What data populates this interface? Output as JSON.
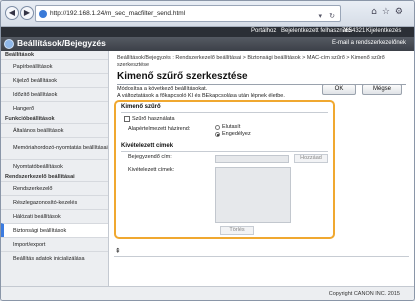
{
  "browser": {
    "url": "http://192.168.1.24/m_sec_macfilter_send.html",
    "back_icon": "back-arrow-icon",
    "forward_icon": "forward-arrow-icon"
  },
  "topbar": {
    "portal": "Portálhoz",
    "login_user": "Bejelentkezett felhasználó:",
    "user_id": "7654321",
    "logout": "Kijelentkezés"
  },
  "header": {
    "title": "Beállítások/Bejegyzés",
    "admin_mail": "E-mail a rendszerkezelőnek"
  },
  "sidebar": {
    "section_settings": "Beállítások",
    "item_paper": "Papírbeállítások",
    "item_display": "Kijelző beállítások",
    "item_timer": "Időzítő beállítások",
    "item_sound": "Hangerő",
    "section_functions": "Funkcióbeállítások",
    "item_general": "Általános beállítások",
    "item_store_access": "Memóriahordozó-nyomtatás beállításai",
    "item_printer": "Nyomtatóbeállítások",
    "section_admin": "Rendszerkezelő beállításai",
    "item_sysadmin": "Rendszerkezelő",
    "item_dept": "Részlegazonosító-kezelés",
    "item_network": "Hálózati beállítások",
    "item_security": "Biztonsági beállítások",
    "item_import": "Import/export",
    "item_init": "Beállítás adatok inicializálása"
  },
  "main": {
    "breadcrumb": "Beállítások/Bejegyzés : Rendszerkezelő beállításai > Biztonsági beállítások > MAC-cím szűrő > Kimenő szűrő szerkesztése",
    "title": "Kimenő szűrő szerkesztése",
    "instruction_1": "Módosítsa a következő beállításokat.",
    "instruction_2": "A változtatások a főkapcsoló KI és BEkapcsolása után lépnek életbe.",
    "ok_label": "OK",
    "cancel_label": "Mégse",
    "group_filter": "Kimenő szűrő",
    "use_filter_label": "Szűrő használata",
    "default_policy_label": "Alapértelmezett házirend:",
    "reject_label": "Elutasít",
    "allow_label": "Engedélyez",
    "group_exceptions": "Kivételezett címek",
    "address_label": "Bejegyzendő cím:",
    "add_label": "Hozzáad",
    "exceptions_label": "Kivételezett címek:",
    "delete_label": "Törlés",
    "top_icon": "scroll-to-top-icon"
  },
  "footer": {
    "copyright": "Copyright CANON INC. 2015"
  }
}
